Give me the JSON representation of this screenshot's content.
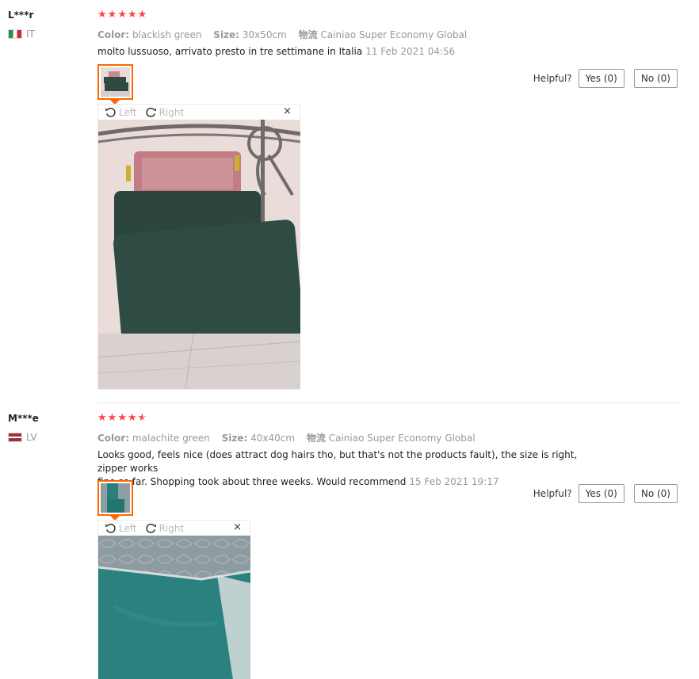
{
  "reviews": [
    {
      "user": "L***r",
      "country": "IT",
      "rating": 5,
      "sku": [
        {
          "label": "Color:",
          "value": "blackish green"
        },
        {
          "label": "Size:",
          "value": "30x50cm"
        },
        {
          "label": "物流",
          "value": "Cainiao Super Economy Global"
        }
      ],
      "text": "molto lussuoso, arrivato presto in tre settimane in Italia",
      "date": "11 Feb 2021 04:56",
      "helpful_label": "Helpful?",
      "yes_label": "Yes (0)",
      "no_label": "No (0)",
      "viewer": {
        "left_label": "Left",
        "right_label": "Right",
        "close_label": "×"
      }
    },
    {
      "user": "M***e",
      "country": "LV",
      "rating": 4.5,
      "sku": [
        {
          "label": "Color:",
          "value": "malachite green"
        },
        {
          "label": "Size:",
          "value": "40x40cm"
        },
        {
          "label": "物流",
          "value": "Cainiao Super Economy Global"
        }
      ],
      "text_line1": "Looks good, feels nice (does attract dog hairs tho, but that's not the products fault), the size is right, zipper works",
      "text_line2": "fine so far. Shopping took about three weeks. Would recommend",
      "date": "15 Feb 2021 19:17",
      "helpful_label": "Helpful?",
      "yes_label": "Yes (0)",
      "no_label": "No (0)",
      "viewer": {
        "left_label": "Left",
        "right_label": "Right",
        "close_label": "×"
      }
    }
  ],
  "colors": {
    "star": "#ff4444",
    "accent": "#ff6600"
  },
  "icons": [
    "rotate-left-icon",
    "rotate-right-icon",
    "close-icon",
    "star-icon",
    "flag-icon"
  ]
}
